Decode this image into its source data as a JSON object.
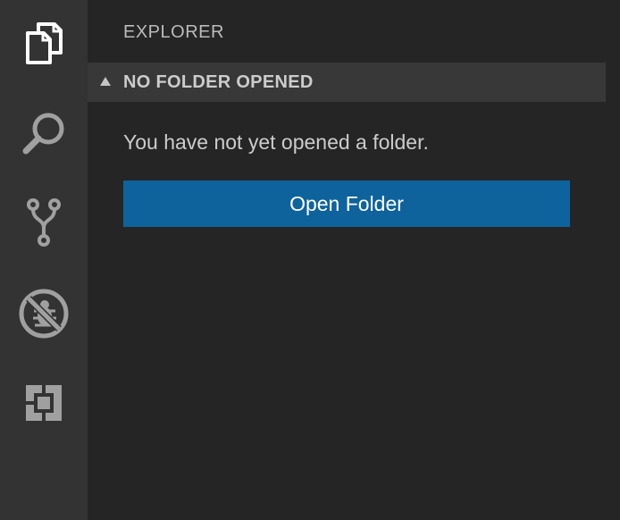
{
  "colors": {
    "activity_bar_bg": "#333333",
    "sidebar_bg": "#252526",
    "section_header_bg": "#383838",
    "button_bg": "#0e639c",
    "icon_active": "#ffffff",
    "icon_inactive": "#a0a0a0"
  },
  "activity_bar": {
    "items": [
      {
        "icon": "files-icon",
        "active": true
      },
      {
        "icon": "search-icon",
        "active": false
      },
      {
        "icon": "source-control-icon",
        "active": false
      },
      {
        "icon": "debug-icon",
        "active": false
      },
      {
        "icon": "extensions-icon",
        "active": false
      }
    ]
  },
  "sidebar": {
    "title": "EXPLORER",
    "section": {
      "title": "NO FOLDER OPENED",
      "expanded": true,
      "twisty_icon": "chevron-down-icon"
    },
    "empty_message": "You have not yet opened a folder.",
    "open_folder_label": "Open Folder"
  }
}
